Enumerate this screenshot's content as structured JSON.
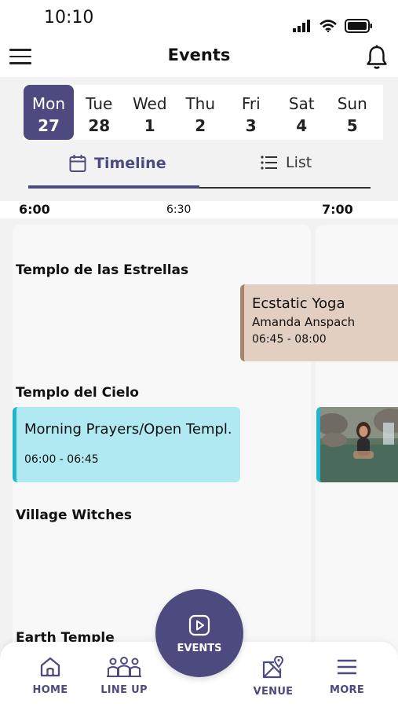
{
  "status": {
    "time": "10:10"
  },
  "header": {
    "title": "Events"
  },
  "dates": [
    {
      "dow": "Mon",
      "day": "27",
      "selected": true
    },
    {
      "dow": "Tue",
      "day": "28"
    },
    {
      "dow": "Wed",
      "day": "1"
    },
    {
      "dow": "Thu",
      "day": "2"
    },
    {
      "dow": "Fri",
      "day": "3"
    },
    {
      "dow": "Sat",
      "day": "4"
    },
    {
      "dow": "Sun",
      "day": "5"
    }
  ],
  "view_tabs": {
    "timeline": "Timeline",
    "list": "List",
    "active": "timeline"
  },
  "timeline": {
    "times": [
      "6:00",
      "6:30",
      "7:00"
    ],
    "venues": [
      "Templo de las Estrellas",
      "Templo del Cielo",
      "Village Witches",
      "Earth Temple"
    ],
    "events": [
      {
        "title": "Ecstatic Yoga",
        "host": "Amanda Anspach",
        "time": "06:45 - 08:00",
        "color": "#e3cfc2",
        "accent": "#a5856d"
      },
      {
        "title": "Morning Prayers/Open Templ...",
        "time": "06:00 - 06:45",
        "color": "#b1e9f3",
        "accent": "#1fb5d0"
      }
    ]
  },
  "bottom_nav": {
    "home": "HOME",
    "lineup": "LINE UP",
    "events": "EVENTS",
    "venue": "VENUE",
    "more": "MORE"
  },
  "colors": {
    "brand": "#4d4a80",
    "background": "#f2f2f2"
  }
}
